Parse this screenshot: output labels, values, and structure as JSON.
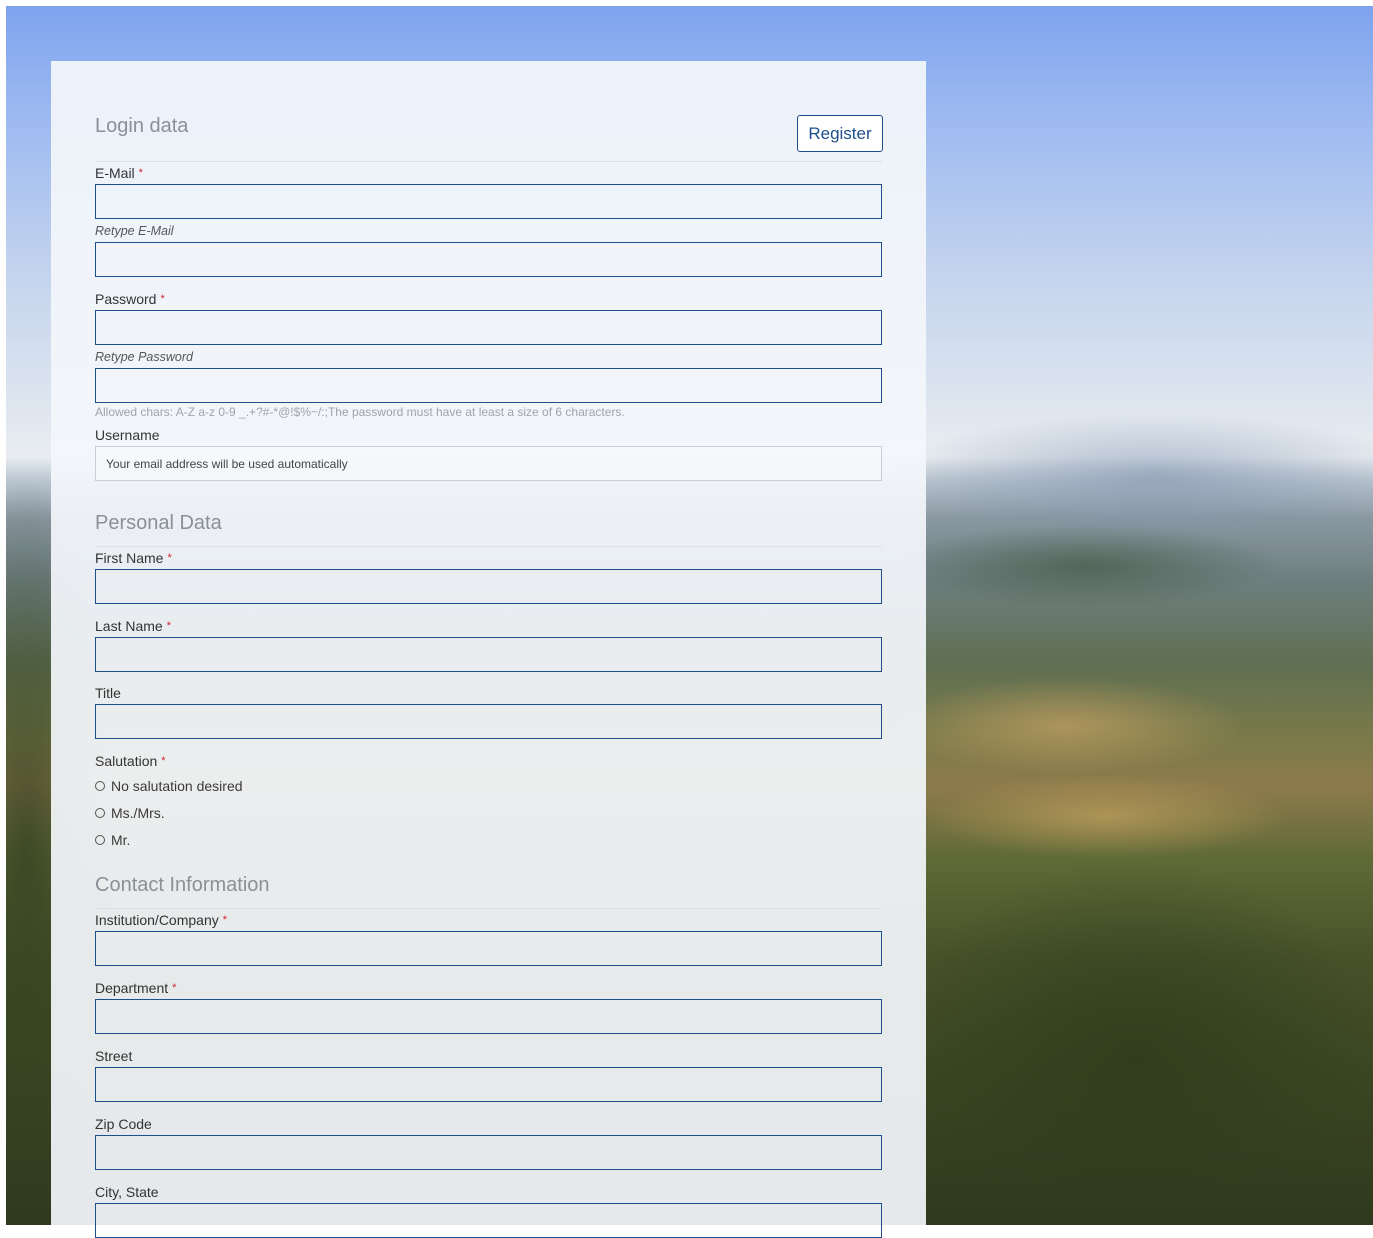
{
  "login": {
    "section_title": "Login data",
    "register_label": "Register",
    "email_label": "E-Mail",
    "retype_email_label": "Retype E-Mail",
    "password_label": "Password",
    "retype_password_label": "Retype Password",
    "password_hint": "Allowed chars: A-Z a-z 0-9 _.+?#-*@!$%~/:;The password must have at least a size of 6 characters.",
    "username_label": "Username",
    "username_value": "Your email address will be used automatically",
    "required_marker": "*"
  },
  "personal": {
    "section_title": "Personal Data",
    "first_name_label": "First Name",
    "last_name_label": "Last Name",
    "title_label": "Title",
    "salutation_label": "Salutation",
    "salutation_options": [
      "No salutation desired",
      "Ms./Mrs.",
      "Mr."
    ]
  },
  "contact": {
    "section_title": "Contact Information",
    "institution_label": "Institution/Company",
    "department_label": "Department",
    "street_label": "Street",
    "zip_label": "Zip Code",
    "city_label": "City, State"
  },
  "colors": {
    "accent": "#1f4e8c",
    "required": "#d21f2a"
  }
}
